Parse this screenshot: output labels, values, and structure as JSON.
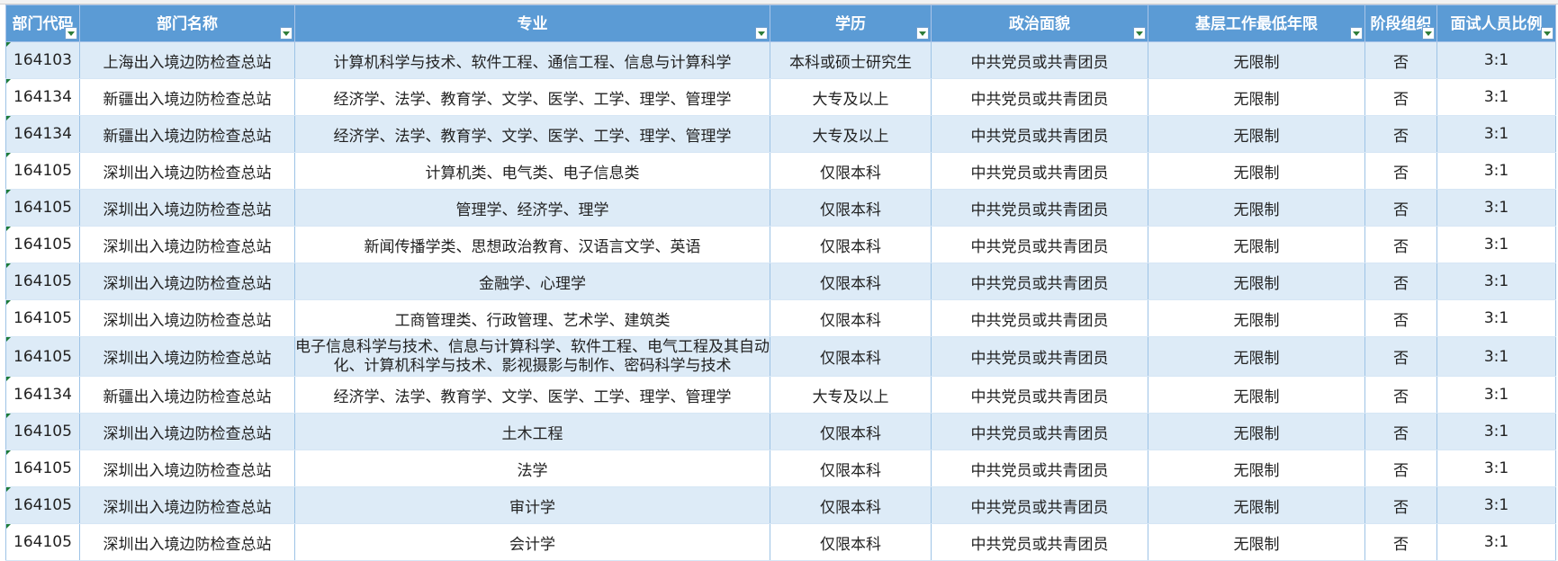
{
  "columns": [
    {
      "key": "code",
      "label": "部门代码"
    },
    {
      "key": "dept",
      "label": "部门名称"
    },
    {
      "key": "major",
      "label": "专业"
    },
    {
      "key": "edu",
      "label": "学历"
    },
    {
      "key": "political",
      "label": "政治面貌"
    },
    {
      "key": "years",
      "label": "基层工作最低年限"
    },
    {
      "key": "stage",
      "label": "阶段组织"
    },
    {
      "key": "ratio",
      "label": "面试人员比例"
    }
  ],
  "rows": [
    {
      "code": "164103",
      "dept": "上海出入境边防检查总站",
      "major": "计算机科学与技术、软件工程、通信工程、信息与计算科学",
      "edu": "本科或硕士研究生",
      "political": "中共党员或共青团员",
      "years": "无限制",
      "stage": "否",
      "ratio": "3:1"
    },
    {
      "code": "164134",
      "dept": "新疆出入境边防检查总站",
      "major": "经济学、法学、教育学、文学、医学、工学、理学、管理学",
      "edu": "大专及以上",
      "political": "中共党员或共青团员",
      "years": "无限制",
      "stage": "否",
      "ratio": "3:1"
    },
    {
      "code": "164134",
      "dept": "新疆出入境边防检查总站",
      "major": "经济学、法学、教育学、文学、医学、工学、理学、管理学",
      "edu": "大专及以上",
      "political": "中共党员或共青团员",
      "years": "无限制",
      "stage": "否",
      "ratio": "3:1"
    },
    {
      "code": "164105",
      "dept": "深圳出入境边防检查总站",
      "major": "计算机类、电气类、电子信息类",
      "edu": "仅限本科",
      "political": "中共党员或共青团员",
      "years": "无限制",
      "stage": "否",
      "ratio": "3:1"
    },
    {
      "code": "164105",
      "dept": "深圳出入境边防检查总站",
      "major": "管理学、经济学、理学",
      "edu": "仅限本科",
      "political": "中共党员或共青团员",
      "years": "无限制",
      "stage": "否",
      "ratio": "3:1"
    },
    {
      "code": "164105",
      "dept": "深圳出入境边防检查总站",
      "major": "新闻传播学类、思想政治教育、汉语言文学、英语",
      "edu": "仅限本科",
      "political": "中共党员或共青团员",
      "years": "无限制",
      "stage": "否",
      "ratio": "3:1"
    },
    {
      "code": "164105",
      "dept": "深圳出入境边防检查总站",
      "major": "金融学、心理学",
      "edu": "仅限本科",
      "political": "中共党员或共青团员",
      "years": "无限制",
      "stage": "否",
      "ratio": "3:1"
    },
    {
      "code": "164105",
      "dept": "深圳出入境边防检查总站",
      "major": "工商管理类、行政管理、艺术学、建筑类",
      "edu": "仅限本科",
      "political": "中共党员或共青团员",
      "years": "无限制",
      "stage": "否",
      "ratio": "3:1"
    },
    {
      "code": "164105",
      "dept": "深圳出入境边防检查总站",
      "major": "电子信息科学与技术、信息与计算科学、软件工程、电气工程及其自动化、计算机科学与技术、影视摄影与制作、密码科学与技术",
      "edu": "仅限本科",
      "political": "中共党员或共青团员",
      "years": "无限制",
      "stage": "否",
      "ratio": "3:1"
    },
    {
      "code": "164134",
      "dept": "新疆出入境边防检查总站",
      "major": "经济学、法学、教育学、文学、医学、工学、理学、管理学",
      "edu": "大专及以上",
      "political": "中共党员或共青团员",
      "years": "无限制",
      "stage": "否",
      "ratio": "3:1"
    },
    {
      "code": "164105",
      "dept": "深圳出入境边防检查总站",
      "major": "土木工程",
      "edu": "仅限本科",
      "political": "中共党员或共青团员",
      "years": "无限制",
      "stage": "否",
      "ratio": "3:1"
    },
    {
      "code": "164105",
      "dept": "深圳出入境边防检查总站",
      "major": "法学",
      "edu": "仅限本科",
      "political": "中共党员或共青团员",
      "years": "无限制",
      "stage": "否",
      "ratio": "3:1"
    },
    {
      "code": "164105",
      "dept": "深圳出入境边防检查总站",
      "major": "审计学",
      "edu": "仅限本科",
      "political": "中共党员或共青团员",
      "years": "无限制",
      "stage": "否",
      "ratio": "3:1"
    },
    {
      "code": "164105",
      "dept": "深圳出入境边防检查总站",
      "major": "会计学",
      "edu": "仅限本科",
      "political": "中共党员或共青团员",
      "years": "无限制",
      "stage": "否",
      "ratio": "3:1"
    }
  ],
  "colors": {
    "header": "#5b9bd5",
    "band": "#ddebf7",
    "grid": "#9dc3e6",
    "marker": "#1e7b3a"
  },
  "icons": {
    "filter": "filter-dropdown-icon"
  }
}
